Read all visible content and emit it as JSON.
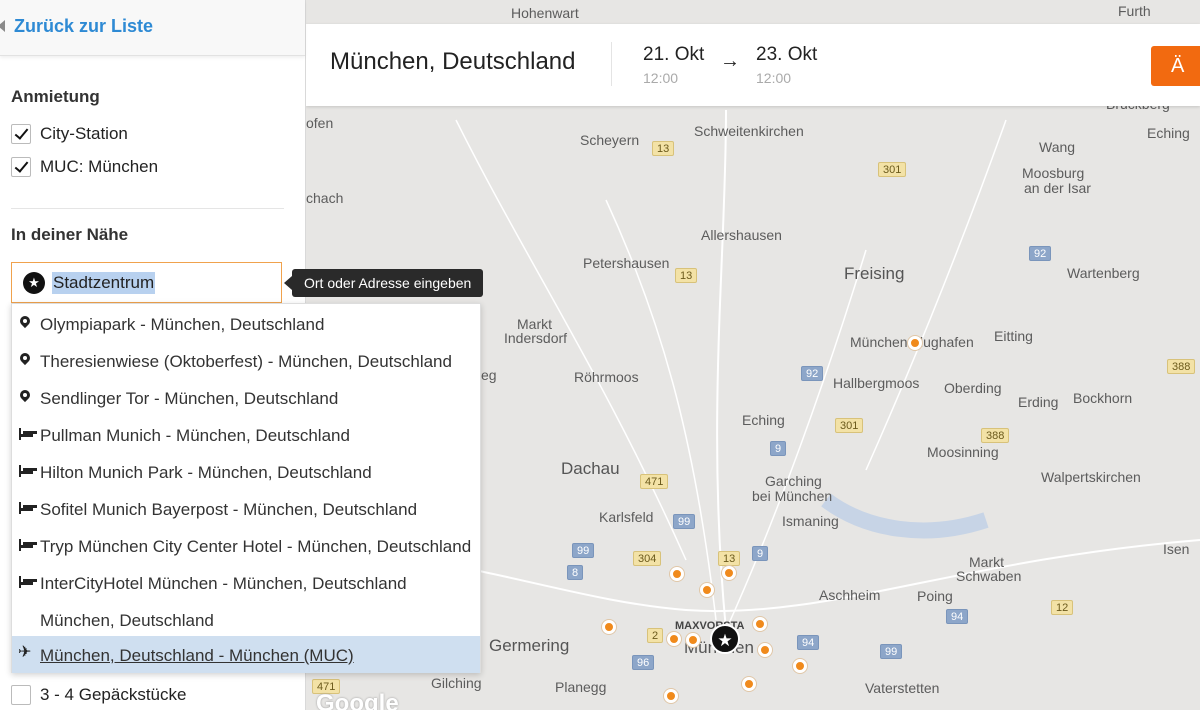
{
  "sidebar": {
    "back_label": "Zurück zur Liste",
    "pickup_title": "Anmietung",
    "pickup_options": [
      {
        "label": "City-Station",
        "checked": true
      },
      {
        "label": "MUC: München",
        "checked": true
      }
    ],
    "nearby_title": "In deiner Nähe",
    "search": {
      "value": "Stadtzentrum",
      "icon": "star-icon"
    },
    "tooltip": "Ort oder Adresse eingeben",
    "suggestions": [
      {
        "icon": "map-marker-icon",
        "label": "Olympiapark - München, Deutschland"
      },
      {
        "icon": "map-marker-icon",
        "label": "Theresienwiese (Oktoberfest) - München, Deutschland"
      },
      {
        "icon": "map-marker-icon",
        "label": "Sendlinger Tor - München, Deutschland"
      },
      {
        "icon": "bed-icon",
        "label": "Pullman Munich - München, Deutschland"
      },
      {
        "icon": "bed-icon",
        "label": "Hilton Munich Park - München, Deutschland"
      },
      {
        "icon": "bed-icon",
        "label": "Sofitel Munich Bayerpost - München, Deutschland"
      },
      {
        "icon": "bed-icon",
        "label": "Tryp München City Center Hotel - München, Deutschland"
      },
      {
        "icon": "bed-icon",
        "label": "InterCityHotel München - München, Deutschland"
      },
      {
        "icon": "",
        "label": "München, Deutschland"
      },
      {
        "icon": "airplane-icon",
        "label": "München, Deutschland - München (MUC)",
        "active": true
      }
    ],
    "luggage_label": "3 - 4 Gepäckstücke"
  },
  "search_bar": {
    "location": "München, Deutschland",
    "pickup_date": "21. Okt",
    "pickup_time": "12:00",
    "return_date": "23. Okt",
    "return_time": "12:00",
    "arrow": "→",
    "button_label": "Ä"
  },
  "map": {
    "places": {
      "hohenwart": "Hohenwart",
      "furth": "Furth",
      "bruckberg": "Bruckberg",
      "ofen": "ofen",
      "scheyern": "Scheyern",
      "schweitenkirchen": "Schweitenkirchen",
      "eching_ne": "Eching",
      "wang": "Wang",
      "moosburg": "Moosburg",
      "moosburg2": "an der Isar",
      "chach": "chach",
      "allershausen": "Allershausen",
      "petershausen": "Petershausen",
      "freising": "Freising",
      "wartenberg": "Wartenberg",
      "markt_indersdorf": "Markt",
      "markt_indersdorf2": "Indersdorf",
      "flughafen": "München Flughafen",
      "eitting": "Eitting",
      "eg": "eg",
      "roehrmoos": "Röhrmoos",
      "hallbergmoos": "Hallbergmoos",
      "oberding": "Oberding",
      "erding": "Erding",
      "bockhorn": "Bockhorn",
      "eching": "Eching",
      "moosinning": "Moosinning",
      "dachau": "Dachau",
      "garching": "Garching",
      "garching2": "bei München",
      "walpertskirchen": "Walpertskirchen",
      "karlsfeld": "Karlsfeld",
      "ismaning": "Ismaning",
      "isen": "Isen",
      "markt_schwaben": "Markt",
      "markt_schwaben2": "Schwaben",
      "aschheim": "Aschheim",
      "poing": "Poing",
      "maxvorstadt": "MAXVORSTA",
      "muenchen": "München",
      "germering": "Germering",
      "gilching": "Gilching",
      "planegg": "Planegg",
      "vaterstetten": "Vaterstetten",
      "google": "Google"
    },
    "roads": {
      "r13a": "13",
      "r301a": "301",
      "r92a": "92",
      "r13b": "13",
      "r92b": "92",
      "r388a": "388",
      "r9a": "9",
      "r301b": "301",
      "r388b": "388",
      "r471a": "471",
      "r99a": "99",
      "r99b": "99",
      "r304": "304",
      "r13c": "13",
      "r9b": "9",
      "r8": "8",
      "r94a": "94",
      "r12": "12",
      "r2": "2",
      "r94b": "94",
      "r96": "96",
      "r99c": "99",
      "r471b": "471"
    },
    "colors": {
      "pin": "#f08a1c",
      "accent": "#f26a10",
      "link": "#2e8ad4"
    }
  }
}
